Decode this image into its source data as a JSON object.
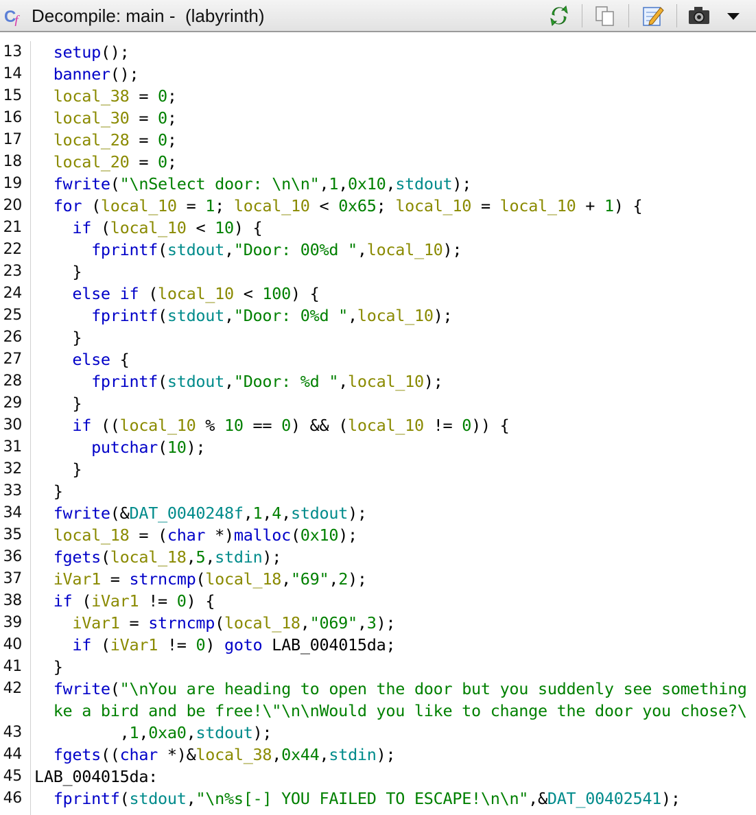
{
  "window": {
    "title": "Decompile: main -  (labyrinth)",
    "toolbar": [
      {
        "icon": "refresh-icon"
      },
      {
        "icon": "copy-icon"
      },
      {
        "icon": "edit-icon"
      },
      {
        "icon": "snapshot-icon"
      },
      {
        "icon": "dropdown-icon"
      }
    ]
  },
  "colors": {
    "function": "#0000c8",
    "variable": "#8a8a00",
    "number": "#008000",
    "string": "#008000",
    "global": "#008b8b"
  },
  "code": {
    "lines": [
      {
        "n": "13",
        "segs": [
          [
            "fn",
            "  setup"
          ],
          [
            "",
            "();"
          ]
        ]
      },
      {
        "n": "14",
        "segs": [
          [
            "fn",
            "  banner"
          ],
          [
            "",
            "();"
          ]
        ]
      },
      {
        "n": "15",
        "segs": [
          [
            "var",
            "  local_38"
          ],
          [
            "",
            " = "
          ],
          [
            "num",
            "0"
          ],
          [
            "",
            ";"
          ]
        ]
      },
      {
        "n": "16",
        "segs": [
          [
            "var",
            "  local_30"
          ],
          [
            "",
            " = "
          ],
          [
            "num",
            "0"
          ],
          [
            "",
            ";"
          ]
        ]
      },
      {
        "n": "17",
        "segs": [
          [
            "var",
            "  local_28"
          ],
          [
            "",
            " = "
          ],
          [
            "num",
            "0"
          ],
          [
            "",
            ";"
          ]
        ]
      },
      {
        "n": "18",
        "segs": [
          [
            "var",
            "  local_20"
          ],
          [
            "",
            " = "
          ],
          [
            "num",
            "0"
          ],
          [
            "",
            ";"
          ]
        ]
      },
      {
        "n": "19",
        "segs": [
          [
            "fn",
            "  fwrite"
          ],
          [
            "",
            "("
          ],
          [
            "str",
            "\"\\nSelect door: \\n\\n\""
          ],
          [
            "",
            ","
          ],
          [
            "num",
            "1"
          ],
          [
            "",
            ","
          ],
          [
            "num",
            "0x10"
          ],
          [
            "",
            ","
          ],
          [
            "glob",
            "stdout"
          ],
          [
            "",
            ");"
          ]
        ]
      },
      {
        "n": "20",
        "segs": [
          [
            "kw",
            "  for"
          ],
          [
            "",
            " ("
          ],
          [
            "var",
            "local_10"
          ],
          [
            "",
            " = "
          ],
          [
            "num",
            "1"
          ],
          [
            "",
            "; "
          ],
          [
            "var",
            "local_10"
          ],
          [
            "",
            " < "
          ],
          [
            "num",
            "0x65"
          ],
          [
            "",
            "; "
          ],
          [
            "var",
            "local_10"
          ],
          [
            "",
            " = "
          ],
          [
            "var",
            "local_10"
          ],
          [
            "",
            " + "
          ],
          [
            "num",
            "1"
          ],
          [
            "",
            ") {"
          ]
        ]
      },
      {
        "n": "21",
        "segs": [
          [
            "kw",
            "    if"
          ],
          [
            "",
            " ("
          ],
          [
            "var",
            "local_10"
          ],
          [
            "",
            " < "
          ],
          [
            "num",
            "10"
          ],
          [
            "",
            ") {"
          ]
        ]
      },
      {
        "n": "22",
        "segs": [
          [
            "fn",
            "      fprintf"
          ],
          [
            "",
            "("
          ],
          [
            "glob",
            "stdout"
          ],
          [
            "",
            ","
          ],
          [
            "str",
            "\"Door: 00%d \""
          ],
          [
            "",
            ","
          ],
          [
            "var",
            "local_10"
          ],
          [
            "",
            ");"
          ]
        ]
      },
      {
        "n": "23",
        "segs": [
          [
            "",
            "    }"
          ]
        ]
      },
      {
        "n": "24",
        "segs": [
          [
            "kw",
            "    else if"
          ],
          [
            "",
            " ("
          ],
          [
            "var",
            "local_10"
          ],
          [
            "",
            " < "
          ],
          [
            "num",
            "100"
          ],
          [
            "",
            ") {"
          ]
        ]
      },
      {
        "n": "25",
        "segs": [
          [
            "fn",
            "      fprintf"
          ],
          [
            "",
            "("
          ],
          [
            "glob",
            "stdout"
          ],
          [
            "",
            ","
          ],
          [
            "str",
            "\"Door: 0%d \""
          ],
          [
            "",
            ","
          ],
          [
            "var",
            "local_10"
          ],
          [
            "",
            ");"
          ]
        ]
      },
      {
        "n": "26",
        "segs": [
          [
            "",
            "    }"
          ]
        ]
      },
      {
        "n": "27",
        "segs": [
          [
            "kw",
            "    else"
          ],
          [
            "",
            " {"
          ]
        ]
      },
      {
        "n": "28",
        "segs": [
          [
            "fn",
            "      fprintf"
          ],
          [
            "",
            "("
          ],
          [
            "glob",
            "stdout"
          ],
          [
            "",
            ","
          ],
          [
            "str",
            "\"Door: %d \""
          ],
          [
            "",
            ","
          ],
          [
            "var",
            "local_10"
          ],
          [
            "",
            ");"
          ]
        ]
      },
      {
        "n": "29",
        "segs": [
          [
            "",
            "    }"
          ]
        ]
      },
      {
        "n": "30",
        "segs": [
          [
            "kw",
            "    if"
          ],
          [
            "",
            " (("
          ],
          [
            "var",
            "local_10"
          ],
          [
            "",
            " % "
          ],
          [
            "num",
            "10"
          ],
          [
            "",
            " == "
          ],
          [
            "num",
            "0"
          ],
          [
            "",
            ") && ("
          ],
          [
            "var",
            "local_10"
          ],
          [
            "",
            " != "
          ],
          [
            "num",
            "0"
          ],
          [
            "",
            ")) {"
          ]
        ]
      },
      {
        "n": "31",
        "segs": [
          [
            "fn",
            "      putchar"
          ],
          [
            "",
            "("
          ],
          [
            "num",
            "10"
          ],
          [
            "",
            ");"
          ]
        ]
      },
      {
        "n": "32",
        "segs": [
          [
            "",
            "    }"
          ]
        ]
      },
      {
        "n": "33",
        "segs": [
          [
            "",
            "  }"
          ]
        ]
      },
      {
        "n": "34",
        "segs": [
          [
            "fn",
            "  fwrite"
          ],
          [
            "",
            "(&"
          ],
          [
            "glob",
            "DAT_0040248f"
          ],
          [
            "",
            ","
          ],
          [
            "num",
            "1"
          ],
          [
            "",
            ","
          ],
          [
            "num",
            "4"
          ],
          [
            "",
            ","
          ],
          [
            "glob",
            "stdout"
          ],
          [
            "",
            ");"
          ]
        ]
      },
      {
        "n": "35",
        "segs": [
          [
            "var",
            "  local_18"
          ],
          [
            "",
            " = ("
          ],
          [
            "typ",
            "char"
          ],
          [
            "",
            " *)"
          ],
          [
            "fn",
            "malloc"
          ],
          [
            "",
            "("
          ],
          [
            "num",
            "0x10"
          ],
          [
            "",
            ");"
          ]
        ]
      },
      {
        "n": "36",
        "segs": [
          [
            "fn",
            "  fgets"
          ],
          [
            "",
            "("
          ],
          [
            "var",
            "local_18"
          ],
          [
            "",
            ","
          ],
          [
            "num",
            "5"
          ],
          [
            "",
            ","
          ],
          [
            "glob",
            "stdin"
          ],
          [
            "",
            ");"
          ]
        ]
      },
      {
        "n": "37",
        "segs": [
          [
            "var",
            "  iVar1"
          ],
          [
            "",
            " = "
          ],
          [
            "fn",
            "strncmp"
          ],
          [
            "",
            "("
          ],
          [
            "var",
            "local_18"
          ],
          [
            "",
            ","
          ],
          [
            "str",
            "\"69\""
          ],
          [
            "",
            ","
          ],
          [
            "num",
            "2"
          ],
          [
            "",
            ");"
          ]
        ]
      },
      {
        "n": "38",
        "segs": [
          [
            "kw",
            "  if"
          ],
          [
            "",
            " ("
          ],
          [
            "var",
            "iVar1"
          ],
          [
            "",
            " != "
          ],
          [
            "num",
            "0"
          ],
          [
            "",
            ") {"
          ]
        ]
      },
      {
        "n": "39",
        "segs": [
          [
            "var",
            "    iVar1"
          ],
          [
            "",
            " = "
          ],
          [
            "fn",
            "strncmp"
          ],
          [
            "",
            "("
          ],
          [
            "var",
            "local_18"
          ],
          [
            "",
            ","
          ],
          [
            "str",
            "\"069\""
          ],
          [
            "",
            ","
          ],
          [
            "num",
            "3"
          ],
          [
            "",
            ");"
          ]
        ]
      },
      {
        "n": "40",
        "segs": [
          [
            "kw",
            "    if"
          ],
          [
            "",
            " ("
          ],
          [
            "var",
            "iVar1"
          ],
          [
            "",
            " != "
          ],
          [
            "num",
            "0"
          ],
          [
            ") "
          ],
          [
            "kw",
            "goto"
          ],
          [
            "",
            " LAB_004015da;"
          ]
        ]
      },
      {
        "n": "41",
        "segs": [
          [
            "",
            "  }"
          ]
        ]
      },
      {
        "n": "42",
        "segs": [
          [
            "fn",
            "  fwrite"
          ],
          [
            "",
            "("
          ],
          [
            "str",
            "\"\\nYou are heading to open the door but you suddenly see something"
          ]
        ]
      },
      {
        "n": "",
        "segs": [
          [
            "str",
            "  ke a bird and be free!\\\"\\n\\nWould you like to change the door you chose?\\"
          ]
        ]
      },
      {
        "n": "43",
        "segs": [
          [
            "",
            "         ,"
          ],
          [
            "num",
            "1"
          ],
          [
            "",
            ","
          ],
          [
            "num",
            "0xa0"
          ],
          [
            "",
            ","
          ],
          [
            "glob",
            "stdout"
          ],
          [
            "",
            ");"
          ]
        ]
      },
      {
        "n": "44",
        "segs": [
          [
            "fn",
            "  fgets"
          ],
          [
            "",
            "(("
          ],
          [
            "typ",
            "char"
          ],
          [
            "",
            " *)&"
          ],
          [
            "var",
            "local_38"
          ],
          [
            "",
            ","
          ],
          [
            "num",
            "0x44"
          ],
          [
            "",
            ","
          ],
          [
            "glob",
            "stdin"
          ],
          [
            "",
            ");"
          ]
        ]
      },
      {
        "n": "45",
        "segs": [
          [
            "lab",
            "LAB_004015da:"
          ]
        ]
      },
      {
        "n": "46",
        "segs": [
          [
            "fn",
            "  fprintf"
          ],
          [
            "",
            "("
          ],
          [
            "glob",
            "stdout"
          ],
          [
            "",
            ","
          ],
          [
            "str",
            "\"\\n%s[-] YOU FAILED TO ESCAPE!\\n\\n\""
          ],
          [
            "",
            ",&"
          ],
          [
            "glob",
            "DAT_00402541"
          ],
          [
            "",
            ");"
          ]
        ]
      }
    ]
  }
}
